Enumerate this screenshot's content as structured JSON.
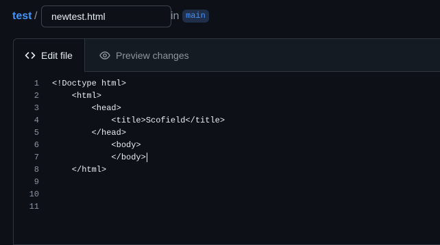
{
  "breadcrumb": {
    "repo": "test",
    "separator": "/",
    "filename_value": "newtest.html",
    "in_label": "in",
    "branch": "main"
  },
  "tabs": {
    "edit": {
      "label": "Edit file",
      "icon": "code-icon"
    },
    "preview": {
      "label": "Preview changes",
      "icon": "eye-icon"
    }
  },
  "code": {
    "lines": [
      {
        "num": "1",
        "text": "<!Doctype html>"
      },
      {
        "num": "2",
        "text": "    <html>"
      },
      {
        "num": "3",
        "text": "        <head>"
      },
      {
        "num": "4",
        "text": "            <title>Scofield</title>"
      },
      {
        "num": "5",
        "text": "        </head>"
      },
      {
        "num": "6",
        "text": "            <body>"
      },
      {
        "num": "7",
        "text": "            </body>"
      },
      {
        "num": "8",
        "text": "    </html>"
      },
      {
        "num": "9",
        "text": ""
      },
      {
        "num": "10",
        "text": ""
      },
      {
        "num": "11",
        "text": ""
      }
    ]
  },
  "colors": {
    "background": "#0d1117",
    "accent": "#4493f8",
    "muted": "#8d96a0",
    "border": "#30363d"
  }
}
